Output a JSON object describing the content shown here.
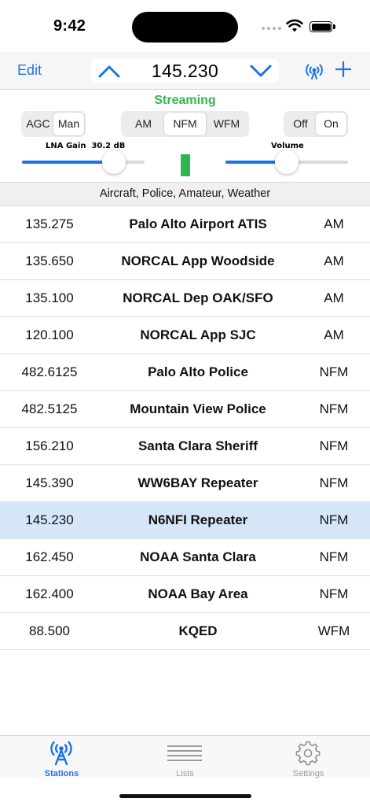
{
  "status_bar": {
    "time": "9:42"
  },
  "toolbar": {
    "edit_label": "Edit",
    "frequency": "145.230"
  },
  "controls": {
    "status": "Streaming",
    "gain_mode": {
      "options": [
        "AGC",
        "Man"
      ],
      "selected": "Man"
    },
    "demod_mode": {
      "options": [
        "AM",
        "NFM",
        "WFM"
      ],
      "selected": "NFM"
    },
    "power": {
      "options": [
        "Off",
        "On"
      ],
      "selected": "On"
    },
    "lna_gain_label": "LNA Gain",
    "lna_gain_value": "30.2 dB",
    "lna_gain_level": 0.75,
    "volume_label": "Volume",
    "volume_level": 0.5
  },
  "list": {
    "section_title": "Aircraft, Police, Amateur, Weather",
    "selected_frequency": "145.230",
    "rows": [
      {
        "freq": "135.275",
        "name": "Palo Alto Airport ATIS",
        "mode": "AM"
      },
      {
        "freq": "135.650",
        "name": "NORCAL App Woodside",
        "mode": "AM"
      },
      {
        "freq": "135.100",
        "name": "NORCAL Dep OAK/SFO",
        "mode": "AM"
      },
      {
        "freq": "120.100",
        "name": "NORCAL App SJC",
        "mode": "AM"
      },
      {
        "freq": "482.6125",
        "name": "Palo Alto Police",
        "mode": "NFM"
      },
      {
        "freq": "482.5125",
        "name": "Mountain View Police",
        "mode": "NFM"
      },
      {
        "freq": "156.210",
        "name": "Santa Clara Sheriff",
        "mode": "NFM"
      },
      {
        "freq": "145.390",
        "name": "WW6BAY Repeater",
        "mode": "NFM"
      },
      {
        "freq": "145.230",
        "name": "N6NFI Repeater",
        "mode": "NFM"
      },
      {
        "freq": "162.450",
        "name": "NOAA Santa Clara",
        "mode": "NFM"
      },
      {
        "freq": "162.400",
        "name": "NOAA Bay Area",
        "mode": "NFM"
      },
      {
        "freq": "88.500",
        "name": "KQED",
        "mode": "WFM"
      }
    ]
  },
  "tabs": [
    {
      "label": "Stations",
      "icon": "antenna-icon",
      "active": true
    },
    {
      "label": "Lists",
      "icon": "lines-icon",
      "active": false
    },
    {
      "label": "Settings",
      "icon": "gear-icon",
      "active": false
    }
  ],
  "colors": {
    "accent": "#1a73e8",
    "status_green": "#2fb74e",
    "selected_row": "#d6e6f9"
  }
}
